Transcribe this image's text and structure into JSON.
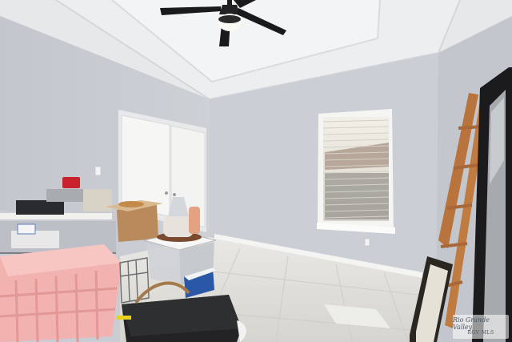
{
  "photo": {
    "subject": "bedroom",
    "palette": {
      "wall": "#c9cdd3",
      "ceiling": "#eceef0",
      "floor": "#e3e2de",
      "trim": "#f4f4f2",
      "ladder_wood": "#b8743c",
      "basket_pink": "#f2b3b0"
    }
  },
  "watermark": {
    "line1": "Rio Grande Valley",
    "line2": "RGV MLS"
  }
}
